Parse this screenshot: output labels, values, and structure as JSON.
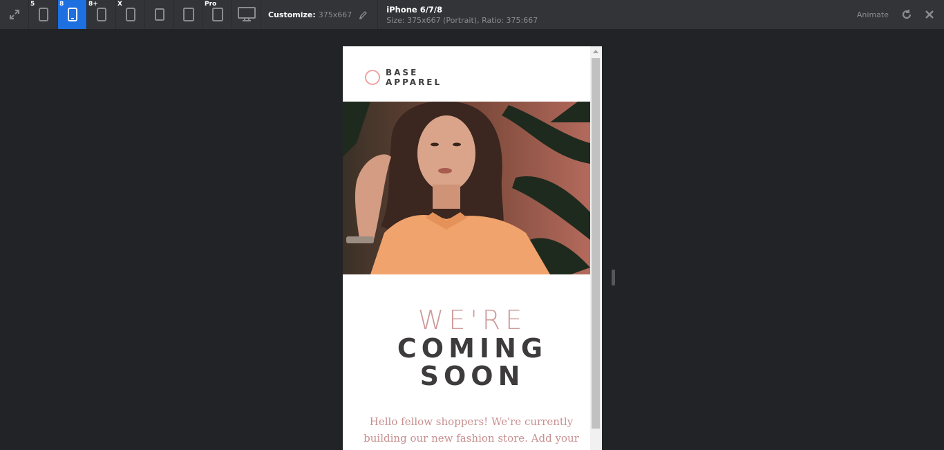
{
  "toolbar": {
    "devices": [
      {
        "badge": "",
        "icon": "fullscreen-icon"
      },
      {
        "badge": "5",
        "icon": "phone-icon"
      },
      {
        "badge": "8",
        "icon": "phone-icon"
      },
      {
        "badge": "8+",
        "icon": "phone-icon"
      },
      {
        "badge": "X",
        "icon": "phone-icon"
      },
      {
        "badge": "",
        "icon": "tablet-icon"
      },
      {
        "badge": "",
        "icon": "tablet-icon"
      },
      {
        "badge": "Pro",
        "icon": "tablet-icon"
      },
      {
        "badge": "",
        "icon": "desktop-icon"
      }
    ],
    "customize_label": "Customize:",
    "customize_value": "375x667",
    "device_name": "iPhone 6/7/8",
    "device_size": "Size: 375x667 (Portrait), Ratio: 375:667",
    "animate_label": "Animate"
  },
  "site": {
    "logo_line1": "BASE",
    "logo_line2": "APPAREL",
    "headline_1": "WE'RE",
    "headline_2": "COMING",
    "headline_3": "SOON",
    "body_line1": "Hello fellow shoppers! We're currently",
    "body_line2": "building our new fashion store. Add your"
  },
  "colors": {
    "accent_blue": "#1e6fe0",
    "logo_pink": "#f0a1a1",
    "headline_pink": "#cf9a9a",
    "headline_dark": "#3d3b3b",
    "body_pink": "#c88f8f"
  }
}
